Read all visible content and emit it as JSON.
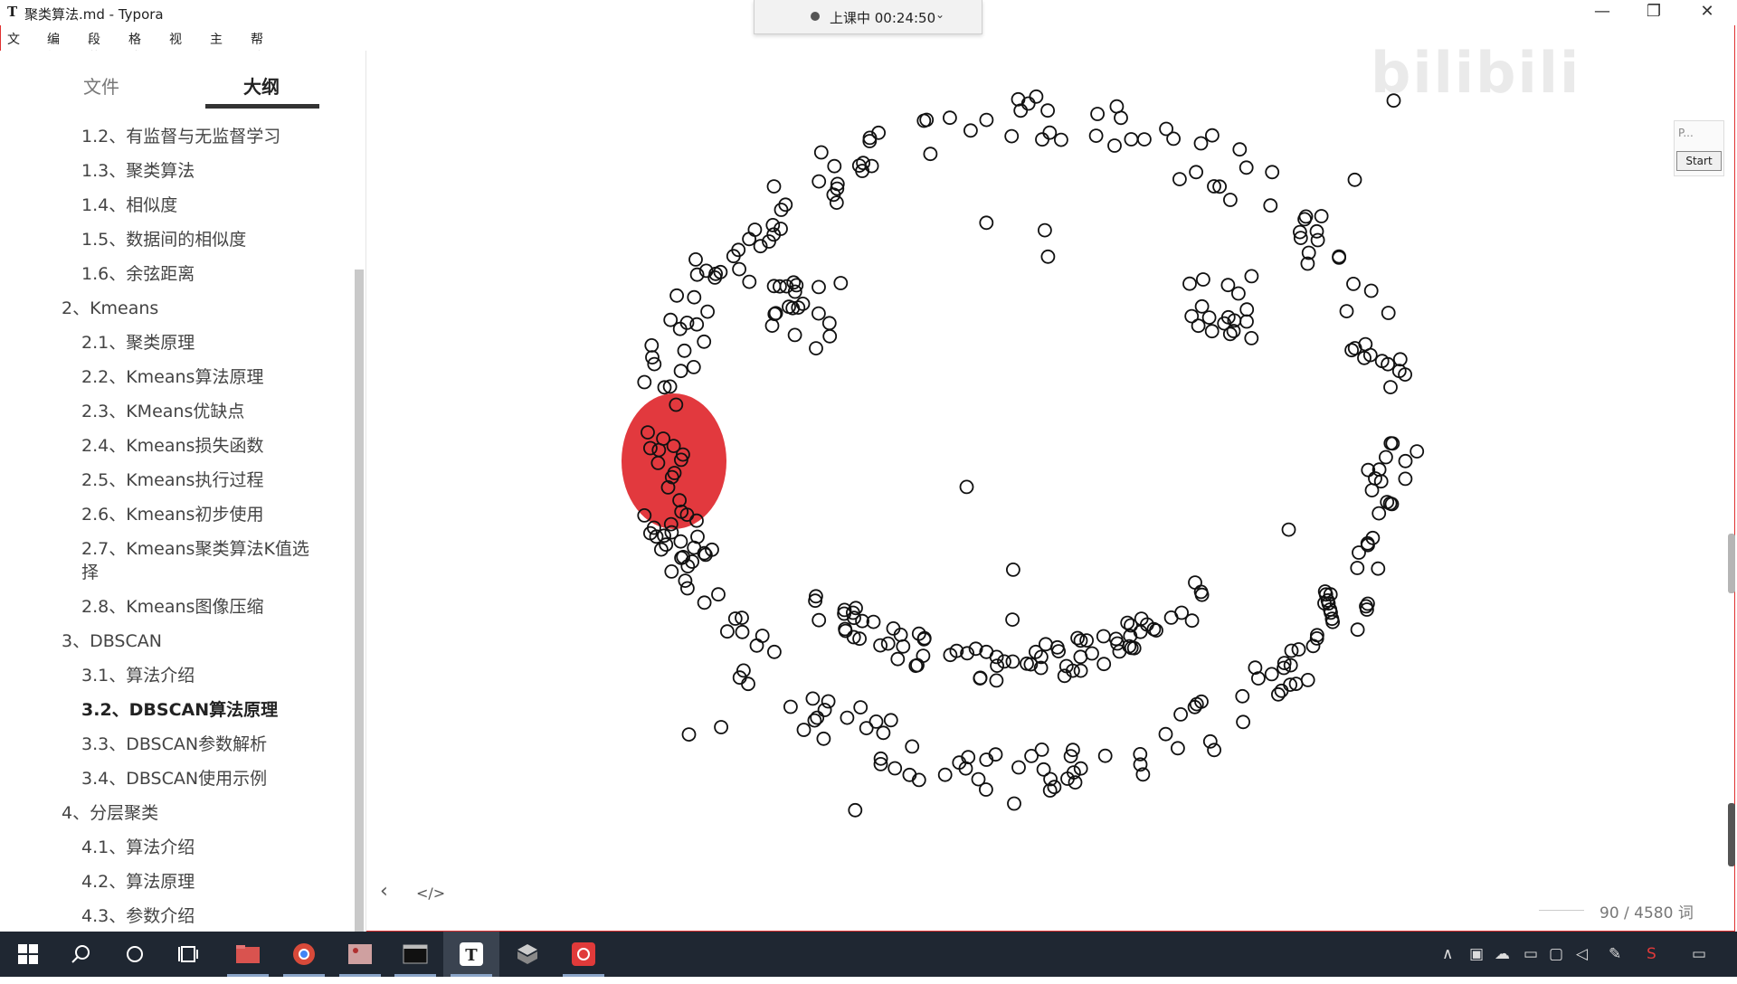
{
  "window": {
    "app_icon": "T",
    "title": "聚类算法.md - Typora",
    "minimize": "—",
    "restore": "❐",
    "close": "✕"
  },
  "recording": {
    "status": "上课中 00:24:50",
    "chevron": "⌄"
  },
  "menu": [
    "文件",
    "编辑",
    "段落",
    "格式",
    "视图",
    "主题",
    "帮助"
  ],
  "sidebar": {
    "tabs": {
      "files": "文件",
      "outline": "大纲"
    },
    "items": [
      {
        "label": "1.2、有监督与无监督学习",
        "level": 2
      },
      {
        "label": "1.3、聚类算法",
        "level": 2
      },
      {
        "label": "1.4、相似度",
        "level": 2
      },
      {
        "label": "1.5、数据间的相似度",
        "level": 2
      },
      {
        "label": "1.6、余弦距离",
        "level": 2
      },
      {
        "label": "2、Kmeans",
        "level": 1
      },
      {
        "label": "2.1、聚类原理",
        "level": 2
      },
      {
        "label": "2.2、Kmeans算法原理",
        "level": 2
      },
      {
        "label": "2.3、KMeans优缺点",
        "level": 2
      },
      {
        "label": "2.4、Kmeans损失函数",
        "level": 2
      },
      {
        "label": "2.5、Kmeans执行过程",
        "level": 2
      },
      {
        "label": "2.6、Kmeans初步使用",
        "level": 2
      },
      {
        "label": "2.7、Kmeans聚类算法K值选",
        "level": 2
      },
      {
        "label": "择",
        "level": 2
      },
      {
        "label": "2.8、Kmeans图像压缩",
        "level": 2
      },
      {
        "label": "3、DBSCAN",
        "level": 1
      },
      {
        "label": "3.1、算法介绍",
        "level": 2
      },
      {
        "label": "3.2、DBSCAN算法原理",
        "level": 2,
        "active": true
      },
      {
        "label": "3.3、DBSCAN参数解析",
        "level": 2
      },
      {
        "label": "3.4、DBSCAN使用示例",
        "level": 2
      },
      {
        "label": "4、分层聚类",
        "level": 1
      },
      {
        "label": "4.1、算法介绍",
        "level": 2
      },
      {
        "label": "4.2、算法原理",
        "level": 2
      },
      {
        "label": "4.3、参数介绍",
        "level": 2
      }
    ]
  },
  "footer": {
    "back_icon": "‹",
    "source_icon": "</>",
    "word_count": "90 / 4580 词"
  },
  "widget": {
    "label": "P...",
    "start": "Start"
  },
  "watermark": "bilibili",
  "colors": {
    "annotation": "#e0282e",
    "point_stroke": "#111111",
    "taskbar": "#1f2732"
  },
  "taskbar": {
    "icons": [
      "windows-start-icon",
      "search-icon",
      "cortana-icon",
      "task-view-icon",
      "file-explorer-icon",
      "chrome-icon",
      "image-viewer-icon",
      "terminal-icon",
      "typora-icon",
      "package-icon",
      "recorder-icon"
    ],
    "tray_icons": [
      "chevron-up-icon",
      "usb-icon",
      "cloud-icon",
      "battery-icon",
      "network-icon",
      "volume-icon",
      "pen-icon",
      "sogou-icon",
      "notification-icon"
    ]
  }
}
